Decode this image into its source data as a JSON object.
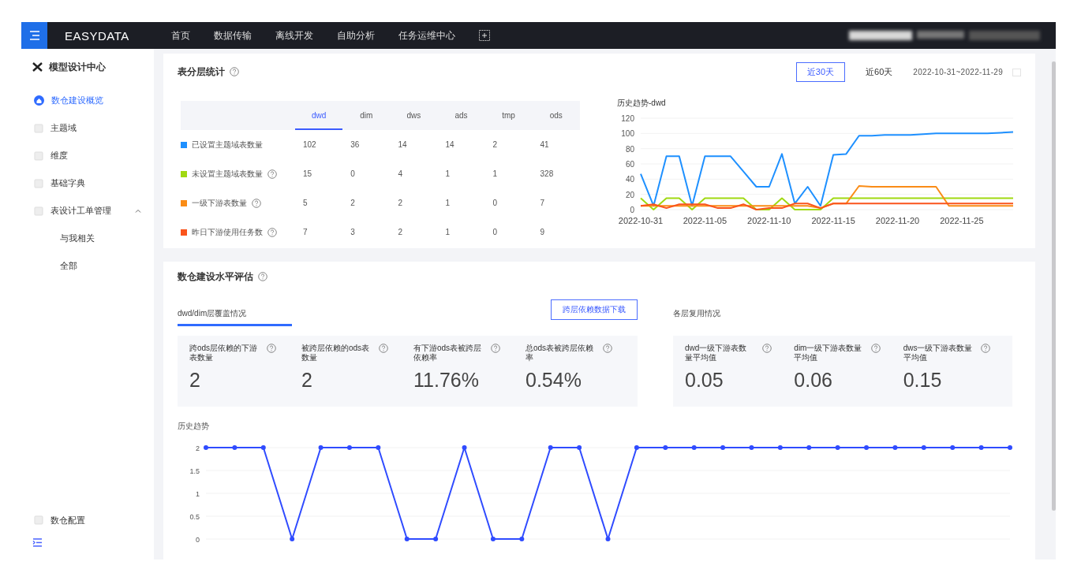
{
  "top_bar": {
    "logo": "EASYDATA",
    "nav": [
      {
        "label": "首页"
      },
      {
        "label": "数据传输"
      },
      {
        "label": "离线开发"
      },
      {
        "label": "自助分析"
      },
      {
        "label": "任务运维中心"
      }
    ]
  },
  "sidebar": {
    "title": "模型设计中心",
    "items": [
      {
        "label": "数仓建设概览",
        "selected": true
      },
      {
        "label": "主题域",
        "selected": false
      },
      {
        "label": "维度",
        "selected": false
      },
      {
        "label": "基础字典",
        "selected": false
      },
      {
        "label": "表设计工单管理",
        "selected": false,
        "expanded": true,
        "children": [
          {
            "label": "与我相关",
            "selected": false
          },
          {
            "label": "全部",
            "selected": false
          }
        ]
      }
    ],
    "footer_item": {
      "label": "数仓配置"
    }
  },
  "layer_stats": {
    "title": "表分层统计",
    "ranges": [
      {
        "label": "近30天",
        "selected": true
      },
      {
        "label": "近60天",
        "selected": false
      }
    ],
    "date_range": "2022-10-31~2022-11-29",
    "table": {
      "columns": [
        {
          "label": "dwd",
          "selected": true
        },
        {
          "label": "dim",
          "selected": false
        },
        {
          "label": "dws",
          "selected": false
        },
        {
          "label": "ads",
          "selected": false
        },
        {
          "label": "tmp",
          "selected": false
        },
        {
          "label": "ods",
          "selected": false
        }
      ],
      "rows": [
        {
          "label": "已设置主题域表数量",
          "help": false,
          "color": "#1e90ff",
          "values": [
            "102",
            "36",
            "14",
            "14",
            "2",
            "41"
          ]
        },
        {
          "label": "未设置主题域表数量",
          "help": true,
          "color": "#a0d911",
          "values": [
            "15",
            "0",
            "4",
            "1",
            "1",
            "328"
          ]
        },
        {
          "label": "一级下游表数量",
          "help": true,
          "color": "#fa8c16",
          "values": [
            "5",
            "2",
            "2",
            "1",
            "0",
            "7"
          ]
        },
        {
          "label": "昨日下游使用任务数",
          "help": true,
          "color": "#fa541c",
          "values": [
            "7",
            "3",
            "2",
            "1",
            "0",
            "9"
          ]
        }
      ]
    },
    "chart_data": {
      "type": "line",
      "title": "历史趋势-dwd",
      "grid": true,
      "categories": [
        "2022-10-31",
        null,
        null,
        null,
        null,
        "2022-11-05",
        null,
        null,
        null,
        null,
        "2022-11-10",
        null,
        null,
        null,
        null,
        "2022-11-15",
        null,
        null,
        null,
        null,
        "2022-11-20",
        null,
        null,
        null,
        null,
        "2022-11-25",
        null,
        null,
        null,
        null
      ],
      "series": [
        {
          "color": "#1e90ff",
          "values": [
            47,
            5,
            70,
            70,
            5,
            70,
            70,
            70,
            50,
            30,
            30,
            73,
            8,
            30,
            5,
            72,
            73,
            97,
            97,
            98,
            98,
            98,
            99,
            100,
            100,
            100,
            100,
            100,
            101,
            102
          ]
        },
        {
          "color": "#a0d911",
          "values": [
            15,
            0,
            15,
            15,
            0,
            15,
            15,
            15,
            15,
            0,
            0,
            15,
            0,
            0,
            0,
            15,
            15,
            15,
            15,
            15,
            15,
            15,
            15,
            15,
            15,
            15,
            15,
            15,
            15,
            15
          ]
        },
        {
          "color": "#fa8c16",
          "values": [
            5,
            5,
            5,
            5,
            5,
            5,
            5,
            5,
            5,
            5,
            5,
            5,
            5,
            5,
            2,
            8,
            8,
            31,
            30,
            30,
            30,
            30,
            30,
            30,
            5,
            5,
            5,
            5,
            5,
            5
          ]
        },
        {
          "color": "#fa541c",
          "values": [
            5,
            7,
            2,
            7,
            7,
            7,
            2,
            2,
            7,
            0,
            2,
            2,
            8,
            8,
            2,
            8,
            8,
            8,
            8,
            8,
            8,
            8,
            8,
            8,
            8,
            8,
            8,
            8,
            8,
            8
          ]
        }
      ],
      "ylim": [
        0,
        120
      ],
      "yticks": [
        0,
        20,
        40,
        60,
        80,
        100,
        120
      ]
    }
  },
  "evaluation": {
    "title": "数仓建设水平评估",
    "groups": [
      {
        "title": "dwd/dim层覆盖情况",
        "selected": true,
        "button": "跨层依赖数据下载",
        "metrics": [
          {
            "label": "跨ods层依赖的下游表数量",
            "value": "2"
          },
          {
            "label": "被跨层依赖的ods表数量",
            "value": "2"
          },
          {
            "label": "有下游ods表被跨层依赖率",
            "value": "11.76%"
          },
          {
            "label": "总ods表被跨层依赖率",
            "value": "0.54%"
          }
        ]
      },
      {
        "title": "各层复用情况",
        "selected": false,
        "metrics": [
          {
            "label": "dwd一级下游表数量平均值",
            "value": "0.05"
          },
          {
            "label": "dim一级下游表数量平均值",
            "value": "0.06"
          },
          {
            "label": "dws一级下游表数量平均值",
            "value": "0.15"
          }
        ]
      }
    ],
    "chart_data": {
      "type": "line",
      "title": "历史趋势",
      "grid": true,
      "series": [
        {
          "color": "#2f4bff",
          "marker": "circle",
          "values": [
            2,
            2,
            2,
            0,
            2,
            2,
            2,
            0,
            0,
            2,
            0,
            0,
            2,
            2,
            0,
            2,
            2,
            2,
            2,
            2,
            2,
            2,
            2,
            2,
            2,
            2,
            2,
            2,
            2
          ]
        }
      ],
      "ylim": [
        0,
        2
      ],
      "yticks": [
        {
          "value": 0,
          "label": "0"
        },
        {
          "value": 0.5,
          "label": "0.5"
        },
        {
          "value": 1,
          "label": "1"
        },
        {
          "value": 1.5,
          "label": "1.5"
        },
        {
          "value": 2,
          "label": "2"
        }
      ]
    }
  }
}
